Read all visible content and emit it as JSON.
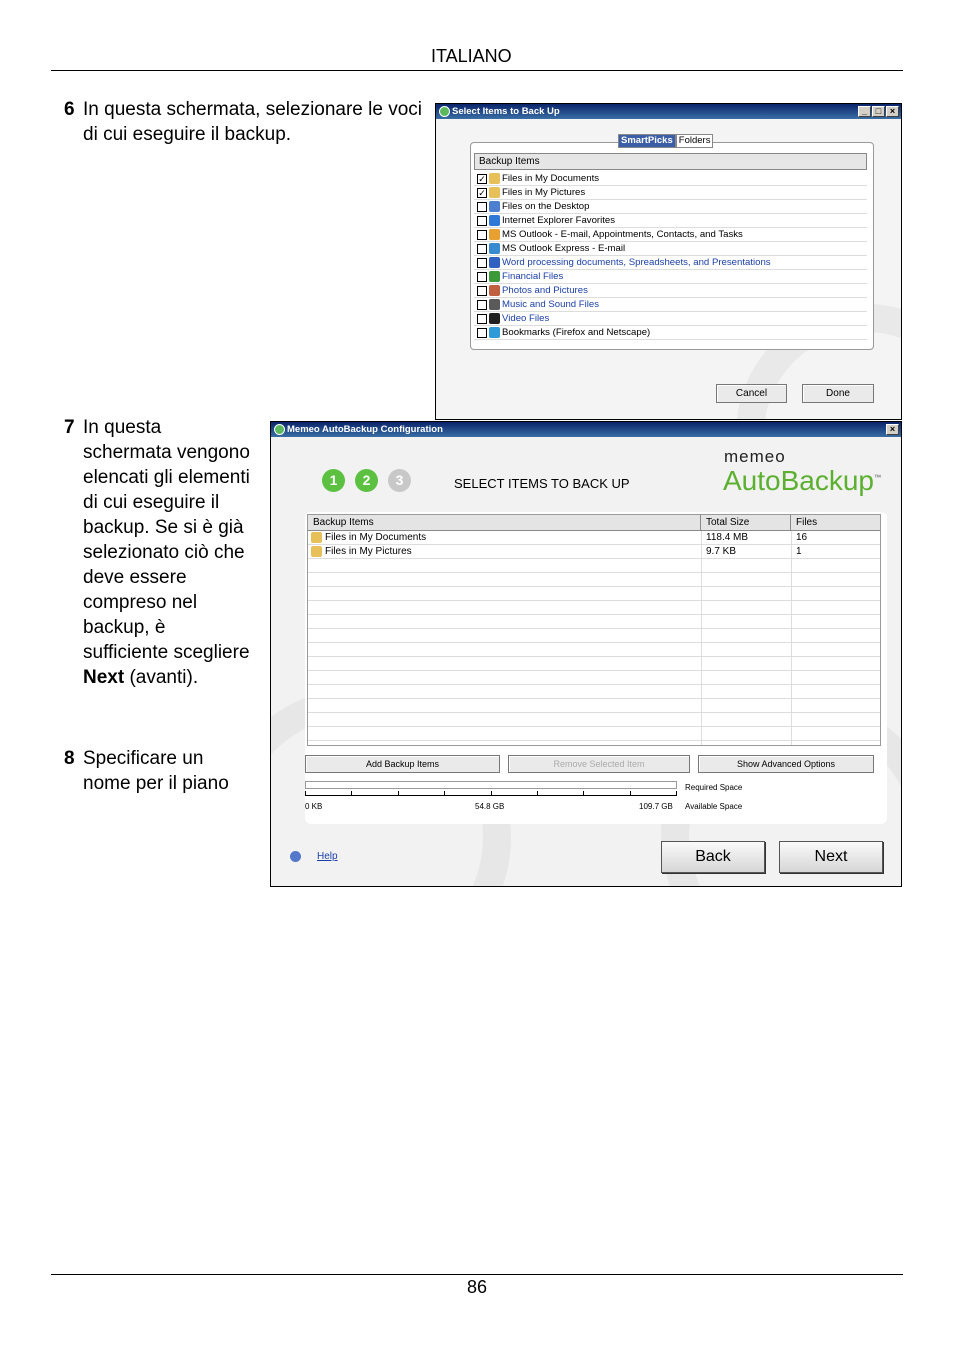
{
  "header": {
    "language": "ITALIANO"
  },
  "steps": [
    {
      "num": "6",
      "text": "In questa schermata, selezionare le voci di cui eseguire il backup."
    },
    {
      "num": "7",
      "text_before": "In questa schermata vengono elencati gli elementi di cui eseguire il backup. Se si è già selezionato ciò che deve essere compreso nel backup, è sufficiente scegliere ",
      "bold": "Next",
      "text_after": " (avanti)."
    },
    {
      "num": "8",
      "text": "Specificare un nome per il piano"
    }
  ],
  "footer": {
    "page": "86"
  },
  "dialog1": {
    "title": "Select Items to Back Up",
    "tabs": [
      "SmartPicks",
      "Folders"
    ],
    "list_header": "Backup Items",
    "items": [
      {
        "label": "Files in My Documents",
        "checked": true,
        "blue": false,
        "icon": "folder-icon",
        "color": "#e8c05a"
      },
      {
        "label": "Files in My Pictures",
        "checked": true,
        "blue": false,
        "icon": "pictures-folder-icon",
        "color": "#e8c05a"
      },
      {
        "label": "Files on the Desktop",
        "checked": false,
        "blue": false,
        "icon": "desktop-icon",
        "color": "#4d7fd0"
      },
      {
        "label": "Internet Explorer Favorites",
        "checked": false,
        "blue": false,
        "icon": "internet-explorer-icon",
        "color": "#2f78d8"
      },
      {
        "label": "MS Outlook - E-mail, Appointments, Contacts, and Tasks",
        "checked": false,
        "blue": false,
        "icon": "outlook-icon",
        "color": "#e8a030"
      },
      {
        "label": "MS Outlook Express - E-mail",
        "checked": false,
        "blue": false,
        "icon": "outlook-express-icon",
        "color": "#3a8ad0"
      },
      {
        "label": "Word processing documents, Spreadsheets, and Presentations",
        "checked": false,
        "blue": true,
        "icon": "document-icon",
        "color": "#3060c0"
      },
      {
        "label": "Financial Files",
        "checked": false,
        "blue": true,
        "icon": "financial-icon",
        "color": "#3a9a3a"
      },
      {
        "label": "Photos and Pictures",
        "checked": false,
        "blue": true,
        "icon": "photos-icon",
        "color": "#c06040"
      },
      {
        "label": "Music and Sound Files",
        "checked": false,
        "blue": true,
        "icon": "music-icon",
        "color": "#5a5a5a"
      },
      {
        "label": "Video Files",
        "checked": false,
        "blue": true,
        "icon": "video-icon",
        "color": "#202020"
      },
      {
        "label": "Bookmarks (Firefox and Netscape)",
        "checked": false,
        "blue": false,
        "icon": "bookmarks-icon",
        "color": "#2f9ad8"
      }
    ],
    "cancel": "Cancel",
    "done": "Done"
  },
  "dialog2": {
    "title": "Memeo AutoBackup Configuration",
    "steps": [
      "1",
      "2",
      "3"
    ],
    "heading": "SELECT ITEMS TO BACK UP",
    "brand_small": "memeo",
    "brand": "AutoBackup",
    "tm": "™",
    "columns": [
      "Backup Items",
      "Total Size",
      "Files"
    ],
    "rows": [
      {
        "item": "Files in My Documents",
        "size": "118.4 MB",
        "files": "16"
      },
      {
        "item": "Files in My Pictures",
        "size": "9.7 KB",
        "files": "1"
      }
    ],
    "add": "Add Backup Items",
    "remove": "Remove Selected Item",
    "advanced": "Show Advanced Options",
    "scale": [
      "0 KB",
      "54.8 GB",
      "109.7 GB"
    ],
    "required": "Required Space",
    "available": "Available Space",
    "help": "Help",
    "back": "Back",
    "next": "Next"
  }
}
